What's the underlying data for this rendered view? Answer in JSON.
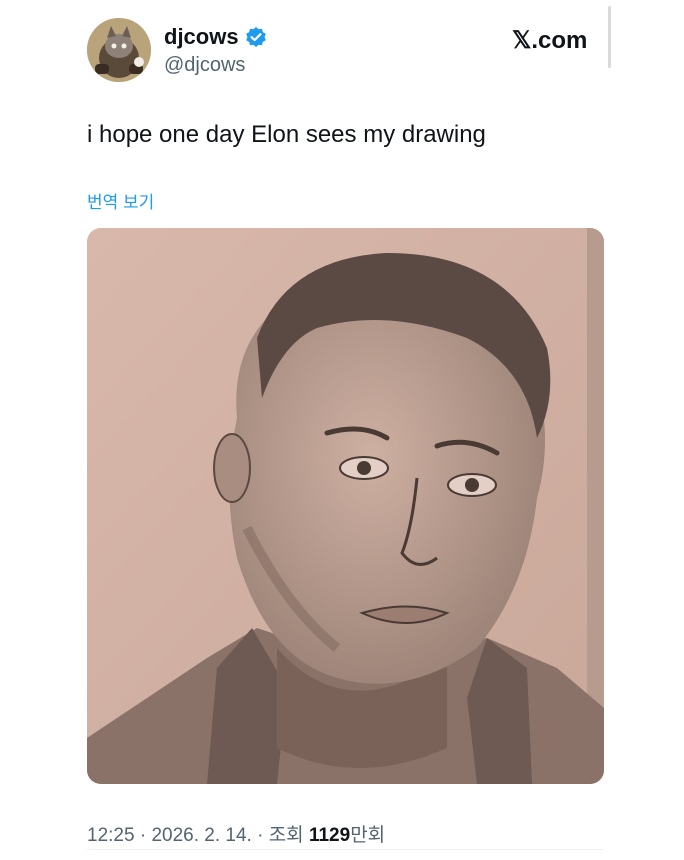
{
  "tweet": {
    "display_name": "djcows",
    "handle": "@djcows",
    "brand": "𝕏.com",
    "text": "i hope one day Elon sees my drawing",
    "translate_label": "번역 보기",
    "time": "12:25",
    "date": "2026. 2. 14.",
    "separator": " · ",
    "views_label": "조회",
    "views_count": "1129",
    "views_unit": "만회",
    "colors": {
      "verified": "#1d9bf0",
      "translate_link": "#1d9bf0",
      "text": "#0f1419",
      "secondary": "#536471"
    },
    "icons": {
      "verified": "verified-badge-icon",
      "brand": "x-logo-icon"
    }
  }
}
